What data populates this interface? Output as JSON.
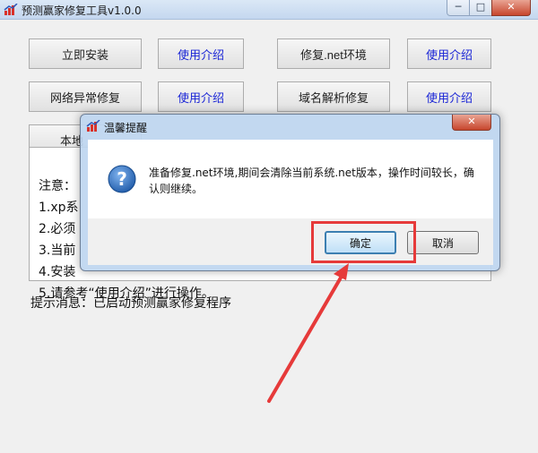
{
  "main": {
    "title": "预测赢家修复工具v1.0.0",
    "controls": {
      "minimize": "─",
      "maximize": "□",
      "close": "✕"
    },
    "buttons": [
      {
        "label": "立即安装"
      },
      {
        "label": "使用介绍"
      },
      {
        "label": "修复.net环境"
      },
      {
        "label": "使用介绍"
      },
      {
        "label": "网络异常修复"
      },
      {
        "label": "使用介绍"
      },
      {
        "label": "域名解析修复"
      },
      {
        "label": "使用介绍"
      },
      {
        "label": "本地"
      }
    ],
    "notes": [
      "注意：",
      "1.xp系",
      "2.必须",
      "3.当前",
      "4.安装",
      "5.请参考“使用介绍”进行操作。"
    ],
    "status": "提示消息：已启动预测赢家修复程序"
  },
  "dialog": {
    "title": "温馨提醒",
    "close": "✕",
    "message": "准备修复.net环境,期间会清除当前系统.net版本，操作时间较长，确认则继续。",
    "ok_label": "确定",
    "cancel_label": "取消"
  },
  "colors": {
    "annotation": "#e63a3a",
    "link": "#1a25d6",
    "question_icon": "#1f5aa8"
  }
}
